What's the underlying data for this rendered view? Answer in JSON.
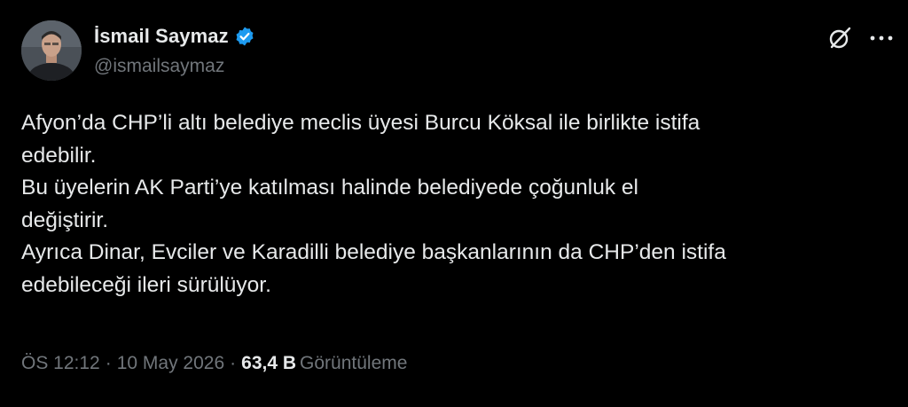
{
  "author": {
    "display_name": "İsmail Saymaz",
    "handle": "@ismailsaymaz",
    "verified": true,
    "verified_color": "#1d9bf0"
  },
  "actions": {
    "grok_icon": "grok-slash-circle-icon",
    "more_icon": "more-horizontal-icon"
  },
  "tweet": {
    "lines": [
      "Afyon’da CHP’li altı belediye meclis üyesi Burcu Köksal ile birlikte istifa",
      "edebilir.",
      "Bu üyelerin AK Parti’ye katılması halinde belediyede çoğunluk el",
      "değiştirir.",
      "Ayrıca Dinar, Evciler ve Karadilli belediye başkanlarının da CHP’den istifa",
      "edebileceği ileri sürülüyor."
    ]
  },
  "meta": {
    "time": "ÖS 12:12",
    "separator": "·",
    "date": "10 May 2026",
    "views_count": "63,4 B",
    "views_label": "Görüntüleme"
  },
  "colors": {
    "background": "#000000",
    "primary_text": "#e7e9ea",
    "secondary_text": "#71767b"
  }
}
